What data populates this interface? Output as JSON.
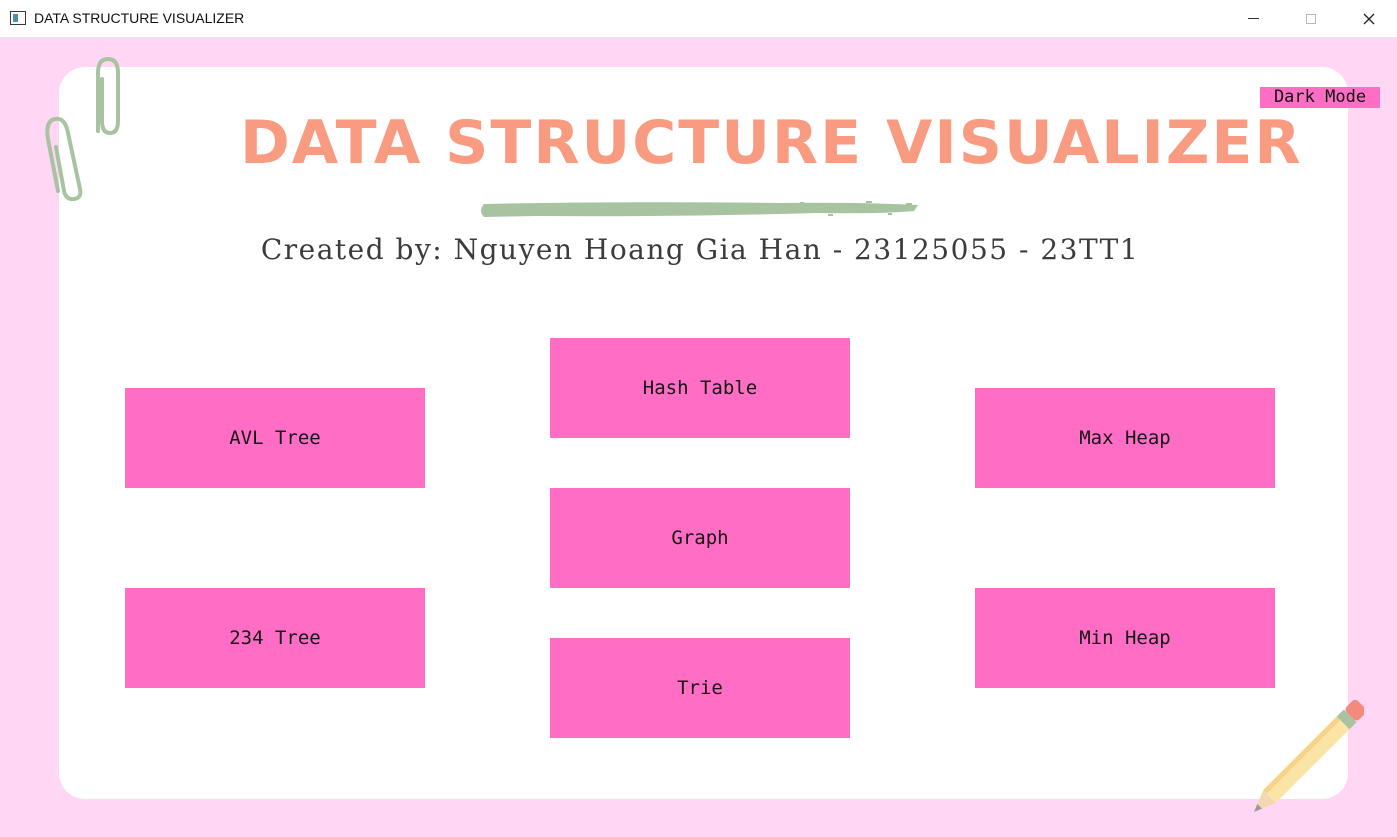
{
  "window": {
    "title": "DATA STRUCTURE VISUALIZER"
  },
  "header": {
    "dark_mode_label": "Dark Mode",
    "title": "DATA STRUCTURE VISUALIZER",
    "subtitle": "Created by: Nguyen Hoang Gia Han - 23125055 - 23TT1"
  },
  "menu": {
    "hash_table": "Hash Table",
    "avl_tree": "AVL Tree",
    "max_heap": "Max Heap",
    "graph": "Graph",
    "tree_234": "234 Tree",
    "min_heap": "Min Heap",
    "trie": "Trie"
  },
  "colors": {
    "background": "#ffd6f4",
    "card": "#ffffff",
    "button": "#ff6ec4",
    "title": "#f99b80",
    "underline": "#a7c3a0"
  },
  "icons": {
    "window": "app-window-icon",
    "minimize": "minimize-icon",
    "maximize": "maximize-icon",
    "close": "close-icon",
    "decoration_top_left": "paperclip-icon",
    "decoration_bottom_right": "pencil-icon"
  }
}
